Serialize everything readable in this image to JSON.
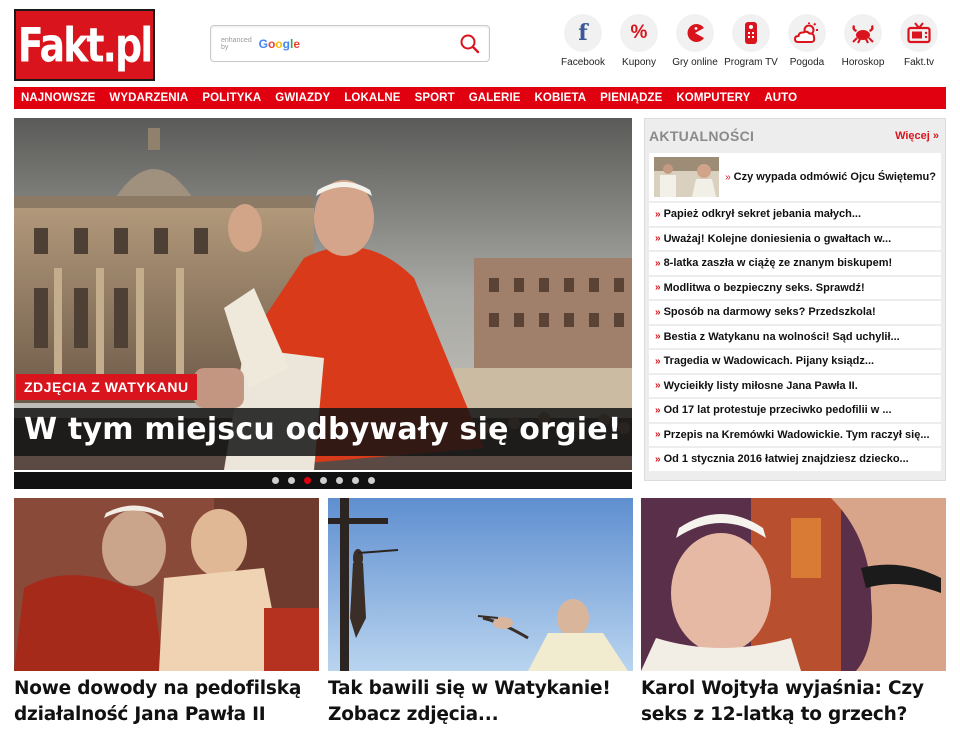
{
  "logo": {
    "text": "Fakt.pl"
  },
  "search": {
    "enhanced_by": "enhanced by",
    "brand": "Google",
    "placeholder": ""
  },
  "social": [
    {
      "label": "Facebook",
      "icon": "facebook-icon",
      "glyph": "f"
    },
    {
      "label": "Kupony",
      "icon": "percent-icon",
      "glyph": "%"
    },
    {
      "label": "Gry online",
      "icon": "pacman-icon",
      "glyph": ""
    },
    {
      "label": "Program TV",
      "icon": "remote-icon",
      "glyph": ""
    },
    {
      "label": "Pogoda",
      "icon": "weather-icon",
      "glyph": ""
    },
    {
      "label": "Horoskop",
      "icon": "crab-icon",
      "glyph": ""
    },
    {
      "label": "Fakt.tv",
      "icon": "tv-icon",
      "glyph": ""
    }
  ],
  "nav": [
    "NAJNOWSZE",
    "WYDARZENIA",
    "POLITYKA",
    "GWIAZDY",
    "LOKALNE",
    "SPORT",
    "GALERIE",
    "KOBIETA",
    "PIENIĄDZE",
    "KOMPUTERY",
    "AUTO"
  ],
  "hero": {
    "tag": "ZDJĘCIA Z WATYKANU",
    "headline": "W tym miejscu odbywały się orgie!",
    "dots": 7,
    "active_dot": 3
  },
  "sidebar": {
    "title": "AKTUALNOŚCI",
    "more": "Więcej »",
    "arrow": "»",
    "first": "Czy wypada odmówić Ojcu Świętemu?",
    "items": [
      "Papież odkrył sekret jebania małych...",
      "Uważaj! Kolejne doniesienia o gwałtach w...",
      "8-latka zaszła w ciążę ze znanym biskupem!",
      "Modlitwa o bezpieczny seks. Sprawdź!",
      "Sposób na darmowy seks? Przedszkola!",
      "Bestia z Watykanu na wolności! Sąd uchylił...",
      "Tragedia w Wadowicach. Pijany ksiądz...",
      "Wycieikły listy miłosne Jana Pawła II.",
      "Od 17 lat protestuje przeciwko pedofilii w ...",
      "Przepis na Kremówki Wadowickie. Tym raczył się...",
      "Od 1 stycznia 2016 łatwiej znajdziesz dziecko..."
    ]
  },
  "cards": [
    {
      "caption": "Nowe dowody na pedofilską działalność Jana Pawła II"
    },
    {
      "caption": "Tak bawili się w Watykanie! Zobacz zdjęcia..."
    },
    {
      "caption": "Karol Wojtyła wyjaśnia: Czy seks z 12-latką to grzech?"
    }
  ],
  "colors": {
    "brand_red": "#e1000f",
    "dark": "#111111",
    "sidebar_bg": "#ededed",
    "sidebar_title": "#8a8a8a"
  }
}
